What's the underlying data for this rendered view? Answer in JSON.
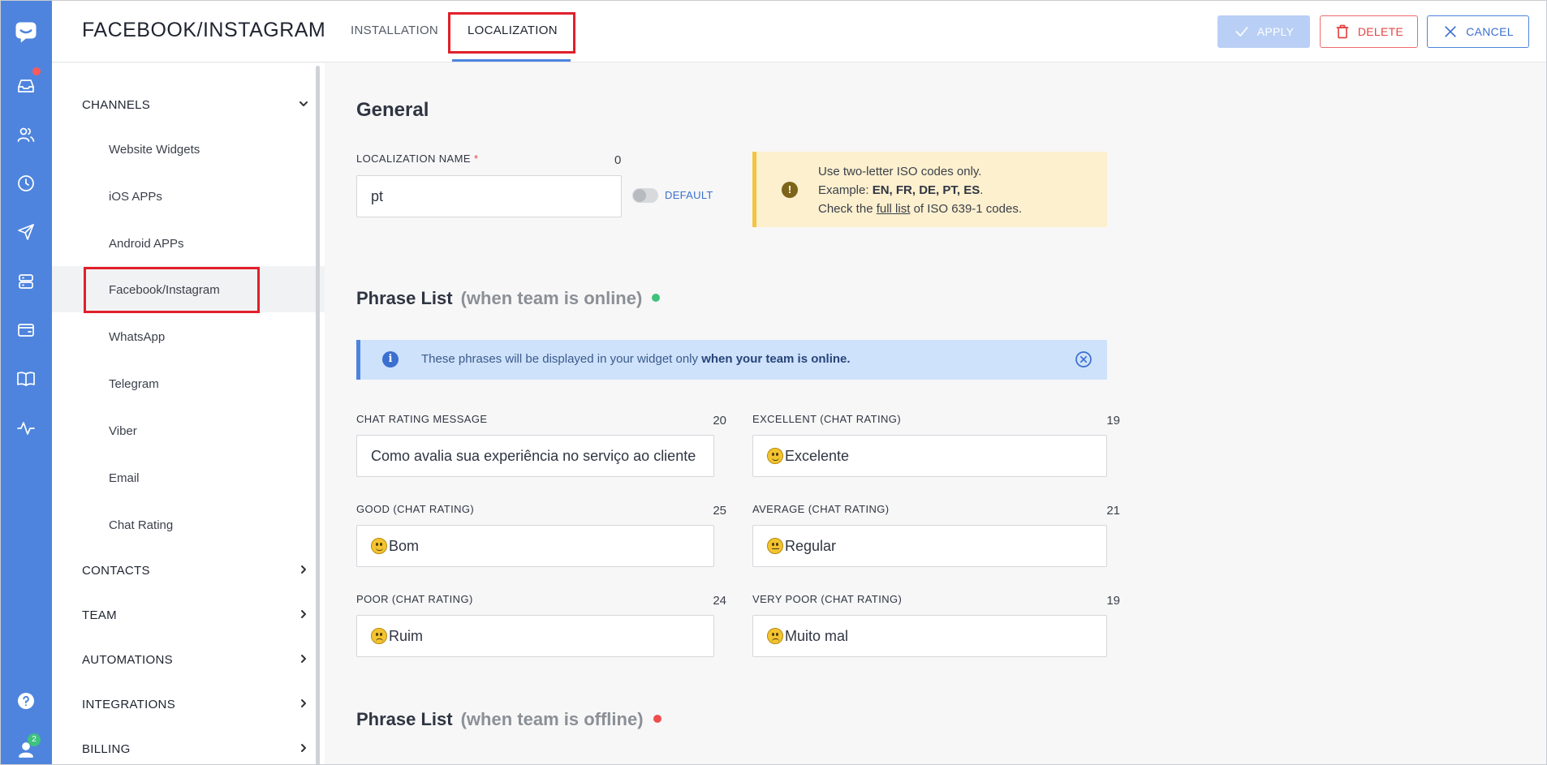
{
  "header": {
    "title": "FACEBOOK/INSTAGRAM",
    "tabs": [
      {
        "label": "INSTALLATION"
      },
      {
        "label": "LOCALIZATION"
      }
    ],
    "apply_label": "APPLY",
    "delete_label": "DELETE",
    "cancel_label": "CANCEL"
  },
  "rail": {
    "icons": [
      "chat-logo-icon",
      "inbox-icon",
      "contacts-icon",
      "history-icon",
      "send-icon",
      "database-icon",
      "wallet-icon",
      "book-icon",
      "activity-icon",
      "help-icon",
      "user-icon"
    ],
    "user_badge": "2"
  },
  "nav": {
    "channels_label": "CHANNELS",
    "items": [
      {
        "label": "Website Widgets"
      },
      {
        "label": "iOS APPs"
      },
      {
        "label": "Android APPs"
      },
      {
        "label": "Facebook/Instagram"
      },
      {
        "label": "WhatsApp"
      },
      {
        "label": "Telegram"
      },
      {
        "label": "Viber"
      },
      {
        "label": "Email"
      },
      {
        "label": "Chat Rating"
      }
    ],
    "sections": [
      {
        "label": "CONTACTS"
      },
      {
        "label": "TEAM"
      },
      {
        "label": "AUTOMATIONS"
      },
      {
        "label": "INTEGRATIONS"
      },
      {
        "label": "BILLING"
      }
    ]
  },
  "general": {
    "heading": "General",
    "localization_label": "LOCALIZATION NAME",
    "required_mark": "*",
    "localization_counter": "0",
    "localization_value": "pt",
    "default_label": "DEFAULT",
    "iso_hint": {
      "line1": "Use two-letter ISO codes only.",
      "example_prefix": "Example: ",
      "example_codes": "EN, FR, DE, PT, ES",
      "example_suffix": ".",
      "line3_prefix": "Check the ",
      "line3_link": "full list",
      "line3_suffix": " of ISO 639-1 codes."
    }
  },
  "phrases_online": {
    "heading": "Phrase List",
    "subheading": "(when team is online)",
    "status_color": "#3ec27e",
    "info_prefix": "These phrases will be displayed in your widget only ",
    "info_bold": "when your team is online.",
    "fields": [
      {
        "label": "CHAT RATING MESSAGE",
        "counter": "20",
        "value": "Como avalia sua experiência no serviço ao cliente"
      },
      {
        "label": "EXCELLENT (CHAT RATING)",
        "counter": "19",
        "value": "Excelente",
        "emoji": "smile"
      },
      {
        "label": "GOOD (CHAT RATING)",
        "counter": "25",
        "value": "Bom",
        "emoji": "slight-smile"
      },
      {
        "label": "AVERAGE (CHAT RATING)",
        "counter": "21",
        "value": "Regular",
        "emoji": "neutral"
      },
      {
        "label": "POOR (CHAT RATING)",
        "counter": "24",
        "value": "Ruim",
        "emoji": "confused"
      },
      {
        "label": "VERY POOR (CHAT RATING)",
        "counter": "19",
        "value": "Muito mal",
        "emoji": "disappointed"
      }
    ]
  },
  "phrases_offline": {
    "heading": "Phrase List",
    "subheading": "(when team is offline)",
    "status_color": "#ef4d4d"
  }
}
